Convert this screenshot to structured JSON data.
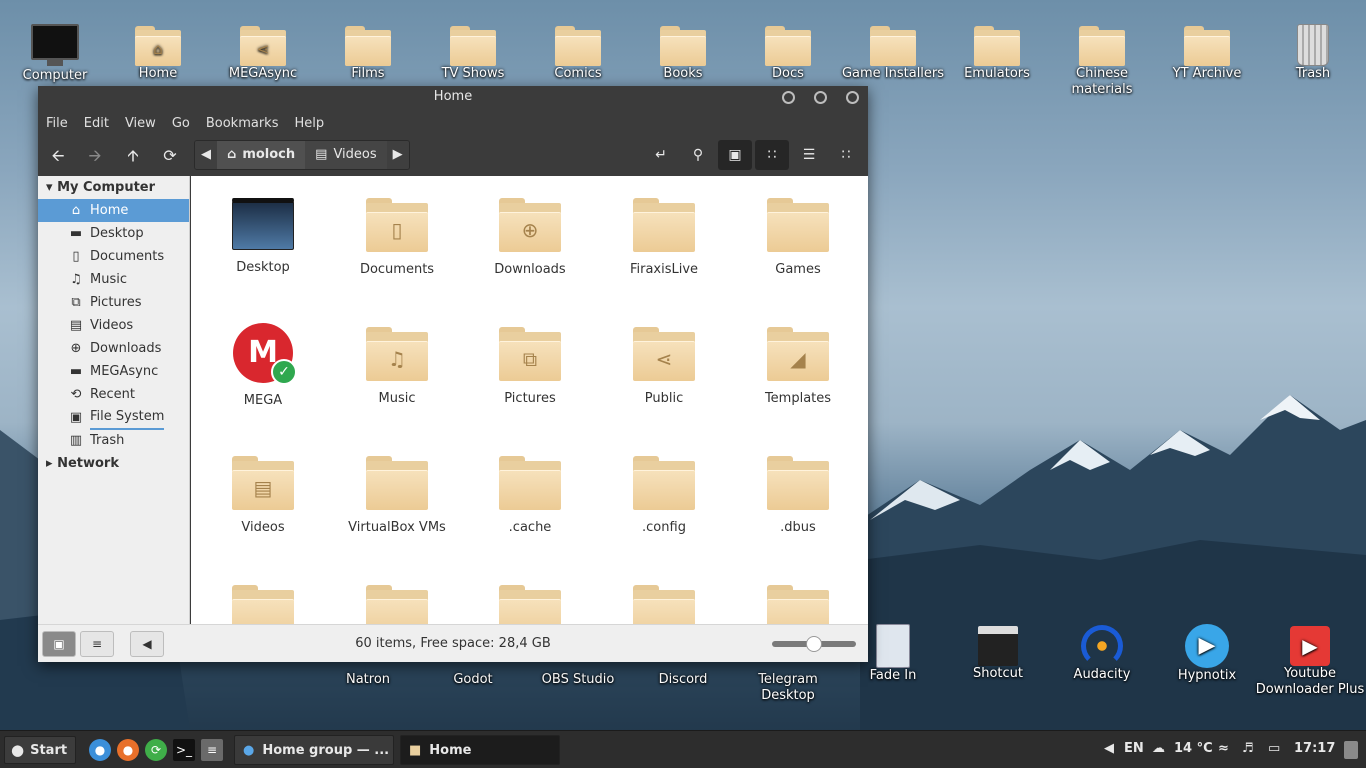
{
  "desktop": {
    "top_icons": [
      {
        "label": "Computer",
        "icon": "monitor-icon"
      },
      {
        "label": "Home",
        "icon": "home-folder-icon",
        "emblem": "⌂"
      },
      {
        "label": "MEGAsync",
        "icon": "share-folder-icon",
        "emblem": "⋖"
      },
      {
        "label": "Films",
        "icon": "folder-icon"
      },
      {
        "label": "TV Shows",
        "icon": "folder-icon"
      },
      {
        "label": "Comics",
        "icon": "folder-icon"
      },
      {
        "label": "Books",
        "icon": "folder-icon"
      },
      {
        "label": "Docs",
        "icon": "folder-icon"
      },
      {
        "label": "Game Installers",
        "icon": "folder-icon"
      },
      {
        "label": "Emulators",
        "icon": "folder-icon"
      },
      {
        "label": "Chinese materials",
        "icon": "folder-icon"
      },
      {
        "label": "YT Archive",
        "icon": "folder-icon"
      },
      {
        "label": "Trash",
        "icon": "trash-icon"
      }
    ],
    "bottom_icons": [
      {
        "label": "Natron"
      },
      {
        "label": "Godot"
      },
      {
        "label": "OBS Studio"
      },
      {
        "label": "Discord"
      },
      {
        "label": "Telegram Desktop"
      },
      {
        "label": "Fade In",
        "icon": "fade-in-icon"
      },
      {
        "label": "Shotcut",
        "icon": "clapperboard-icon"
      },
      {
        "label": "Audacity",
        "icon": "audacity-icon"
      },
      {
        "label": "Hypnotix",
        "icon": "hypnotix-icon"
      },
      {
        "label": "Youtube Downloader Plus",
        "icon": "youtube-icon"
      }
    ]
  },
  "window": {
    "title": "Home",
    "menu": [
      "File",
      "Edit",
      "View",
      "Go",
      "Bookmarks",
      "Help"
    ],
    "path": {
      "home_segment": "moloch",
      "next_segment": "Videos"
    },
    "sidebar": {
      "my_computer": "My Computer",
      "items": [
        {
          "label": "Home",
          "icon": "home-icon",
          "glyph": "⌂"
        },
        {
          "label": "Desktop",
          "icon": "desktop-folder-icon",
          "glyph": "▬"
        },
        {
          "label": "Documents",
          "icon": "document-icon",
          "glyph": "▯"
        },
        {
          "label": "Music",
          "icon": "music-icon",
          "glyph": "♫"
        },
        {
          "label": "Pictures",
          "icon": "pictures-icon",
          "glyph": "⧉"
        },
        {
          "label": "Videos",
          "icon": "film-icon",
          "glyph": "▤"
        },
        {
          "label": "Downloads",
          "icon": "download-icon",
          "glyph": "⊕"
        },
        {
          "label": "MEGAsync",
          "icon": "folder-icon",
          "glyph": "▬"
        },
        {
          "label": "Recent",
          "icon": "recent-icon",
          "glyph": "⟲"
        },
        {
          "label": "File System",
          "icon": "drive-icon",
          "glyph": "▣"
        },
        {
          "label": "Trash",
          "icon": "trash-icon",
          "glyph": "▥"
        }
      ],
      "network": "Network"
    },
    "files": [
      {
        "label": "Desktop",
        "kind": "desktop"
      },
      {
        "label": "Documents",
        "kind": "folder",
        "emblem": "▯"
      },
      {
        "label": "Downloads",
        "kind": "folder",
        "emblem": "⊕"
      },
      {
        "label": "FiraxisLive",
        "kind": "folder",
        "emblem": ""
      },
      {
        "label": "Games",
        "kind": "folder",
        "emblem": ""
      },
      {
        "label": "MEGA",
        "kind": "mega"
      },
      {
        "label": "Music",
        "kind": "folder",
        "emblem": "♫"
      },
      {
        "label": "Pictures",
        "kind": "folder",
        "emblem": "⧉"
      },
      {
        "label": "Public",
        "kind": "folder",
        "emblem": "⋖"
      },
      {
        "label": "Templates",
        "kind": "folder",
        "emblem": "◢"
      },
      {
        "label": "Videos",
        "kind": "folder",
        "emblem": "▤"
      },
      {
        "label": "VirtualBox VMs",
        "kind": "folder",
        "emblem": ""
      },
      {
        "label": ".cache",
        "kind": "folder",
        "emblem": ""
      },
      {
        "label": ".config",
        "kind": "folder",
        "emblem": ""
      },
      {
        "label": ".dbus",
        "kind": "folder",
        "emblem": ""
      }
    ],
    "status": "60 items, Free space: 28,4 GB",
    "zoom_level": 0.5
  },
  "taskbar": {
    "start_label": "Start",
    "tasks": [
      {
        "label": "Home group — ..."
      },
      {
        "label": "Home"
      }
    ],
    "keyboard_layout": "EN",
    "temperature": "14 °C",
    "clock": "17:17"
  }
}
